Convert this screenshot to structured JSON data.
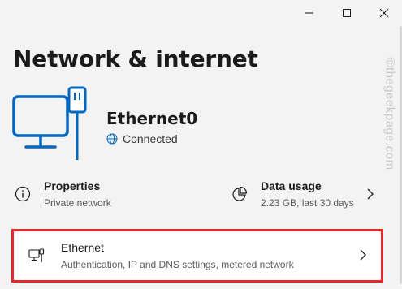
{
  "page": {
    "title": "Network & internet"
  },
  "device": {
    "name": "Ethernet0",
    "status": "Connected"
  },
  "properties": {
    "title": "Properties",
    "subtitle": "Private network"
  },
  "data_usage": {
    "title": "Data usage",
    "subtitle": "2.23 GB, last 30 days"
  },
  "ethernet_row": {
    "title": "Ethernet",
    "subtitle": "Authentication, IP and DNS settings, metered network"
  },
  "watermark": {
    "text": "©thegeekpage.com"
  },
  "icons": {
    "minimize": "minimize-icon",
    "maximize": "maximize-icon",
    "close": "close-icon",
    "hero": "ethernet-monitor-icon",
    "globe": "globe-icon",
    "info": "info-icon",
    "pie": "pie-chart-icon",
    "ethernet": "ethernet-icon",
    "chevron": "chevron-right-icon"
  },
  "colors": {
    "accent": "#0067c0",
    "highlight": "#e32a2a",
    "background": "#f3f3f3"
  }
}
